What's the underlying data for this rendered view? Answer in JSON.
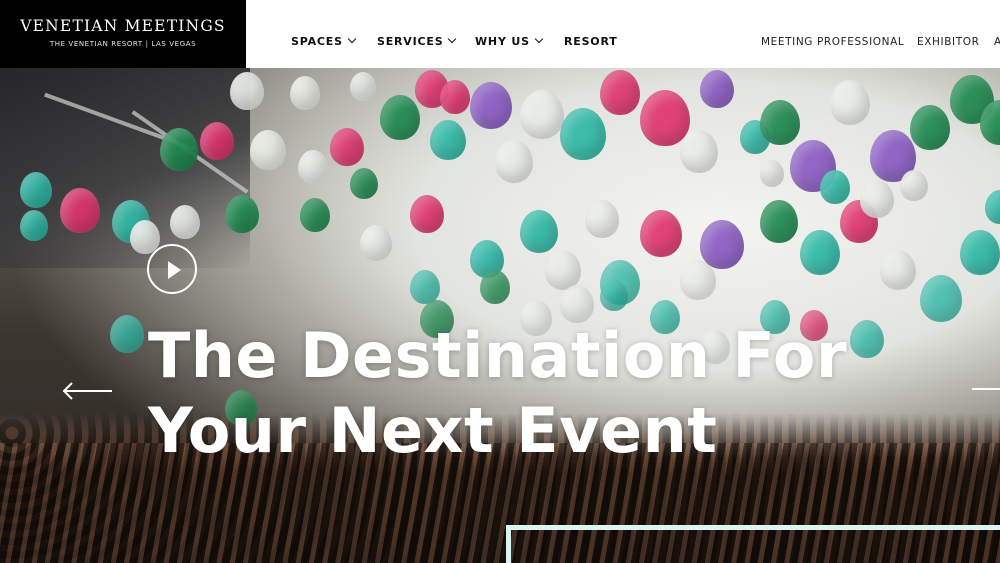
{
  "brand": {
    "title": "VENETIAN MEETINGS",
    "subtitle": "THE VENETIAN RESORT  |  LAS VEGAS"
  },
  "nav": {
    "primary": [
      {
        "label": "SPACES",
        "has_dropdown": true
      },
      {
        "label": "SERVICES",
        "has_dropdown": true
      },
      {
        "label": "WHY US",
        "has_dropdown": true
      },
      {
        "label": "RESORT",
        "has_dropdown": false
      }
    ],
    "utility": [
      {
        "label": "MEETING PROFESSIONAL"
      },
      {
        "label": "EXHIBITOR"
      },
      {
        "label": "A"
      }
    ]
  },
  "hero": {
    "headline_line1": "The Destination For",
    "headline_line2": "Your Next Event",
    "play_icon": "play-circle-icon",
    "prev_icon": "arrow-left-icon",
    "next_icon": "arrow-right-icon"
  },
  "colors": {
    "nav_bg": "#ffffff",
    "logo_bg": "#000000",
    "headline": "#ffffff",
    "balloon_teal": "#2fb9a6",
    "balloon_pink": "#e0356e",
    "balloon_purple": "#8a5bc4",
    "balloon_green": "#1e8a4f",
    "balloon_white": "#e9ece6",
    "frame_accent": "#dcf3f0"
  }
}
